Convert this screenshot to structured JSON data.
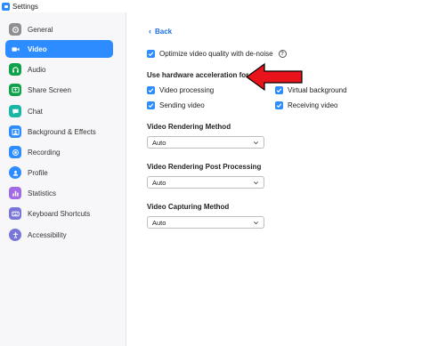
{
  "window": {
    "title": "Settings"
  },
  "sidebar": {
    "items": [
      {
        "label": "General",
        "icon": "gear-icon",
        "color": "#8e8e93",
        "active": false
      },
      {
        "label": "Video",
        "icon": "video-camera-icon",
        "color": "#ffffff",
        "active": true
      },
      {
        "label": "Audio",
        "icon": "headphones-icon",
        "color": "#0ea34b",
        "active": false
      },
      {
        "label": "Share Screen",
        "icon": "share-screen-icon",
        "color": "#0ea34b",
        "active": false
      },
      {
        "label": "Chat",
        "icon": "chat-bubble-icon",
        "color": "#19b6a6",
        "active": false
      },
      {
        "label": "Background & Effects",
        "icon": "background-effects-icon",
        "color": "#2d8cff",
        "active": false
      },
      {
        "label": "Recording",
        "icon": "record-icon",
        "color": "#2d8cff",
        "active": false
      },
      {
        "label": "Profile",
        "icon": "profile-icon",
        "color": "#2d8cff",
        "active": false
      },
      {
        "label": "Statistics",
        "icon": "statistics-icon",
        "color": "#a26be3",
        "active": false
      },
      {
        "label": "Keyboard Shortcuts",
        "icon": "keyboard-icon",
        "color": "#7a76d9",
        "active": false
      },
      {
        "label": "Accessibility",
        "icon": "accessibility-icon",
        "color": "#7a76d9",
        "active": false
      }
    ]
  },
  "main": {
    "back_label": "Back",
    "denoise": {
      "label": "Optimize video quality with de-noise",
      "checked": true
    },
    "hw_accel": {
      "title": "Use hardware acceleration for",
      "options": [
        {
          "label": "Video processing",
          "checked": true
        },
        {
          "label": "Virtual background",
          "checked": true
        },
        {
          "label": "Sending video",
          "checked": true
        },
        {
          "label": "Receiving video",
          "checked": true
        }
      ]
    },
    "rendering_method": {
      "title": "Video Rendering Method",
      "value": "Auto"
    },
    "post_processing": {
      "title": "Video Rendering Post Processing",
      "value": "Auto"
    },
    "capturing_method": {
      "title": "Video Capturing Method",
      "value": "Auto"
    },
    "annotation_arrow": {
      "icon": "red-arrow-icon",
      "color": "#e8131b"
    }
  },
  "theme": {
    "accent": "#2d8cff",
    "sidebar_bg": "#f7f7f9"
  }
}
